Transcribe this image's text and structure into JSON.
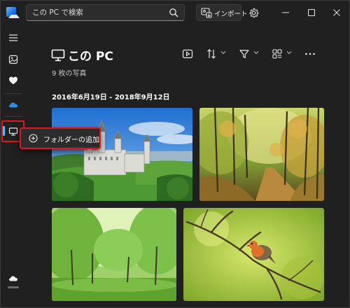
{
  "titlebar": {
    "search": {
      "placeholder": "この PC で検索",
      "value": ""
    },
    "import_label": "インポート"
  },
  "sidebar": {
    "items": [
      {
        "icon": "hamburger-menu-icon"
      },
      {
        "icon": "photo-gallery-icon"
      },
      {
        "icon": "heart-icon"
      },
      {
        "icon": "onedrive-cloud-icon"
      },
      {
        "icon": "this-pc-icon",
        "selected": true
      },
      {
        "icon": "icloud-icon"
      }
    ],
    "accent_color": "#4cc2ff",
    "highlight_color": "#e4141b"
  },
  "flyout": {
    "label": "フォルダーの追加",
    "icon": "add-circle-icon"
  },
  "header": {
    "title": "この PC",
    "count": "9 枚の写真",
    "toolbar": [
      "slideshow-icon",
      "sort-icon",
      "filter-icon",
      "layout-icon",
      "more-icon"
    ]
  },
  "gallery": {
    "date_range": "2016年6月19日 - 2018年9月12日",
    "photos": [
      {
        "subject": "castle-on-hill"
      },
      {
        "subject": "autumn-forest-path"
      },
      {
        "subject": "green-park-trees"
      },
      {
        "subject": "robin-on-branch"
      }
    ]
  }
}
